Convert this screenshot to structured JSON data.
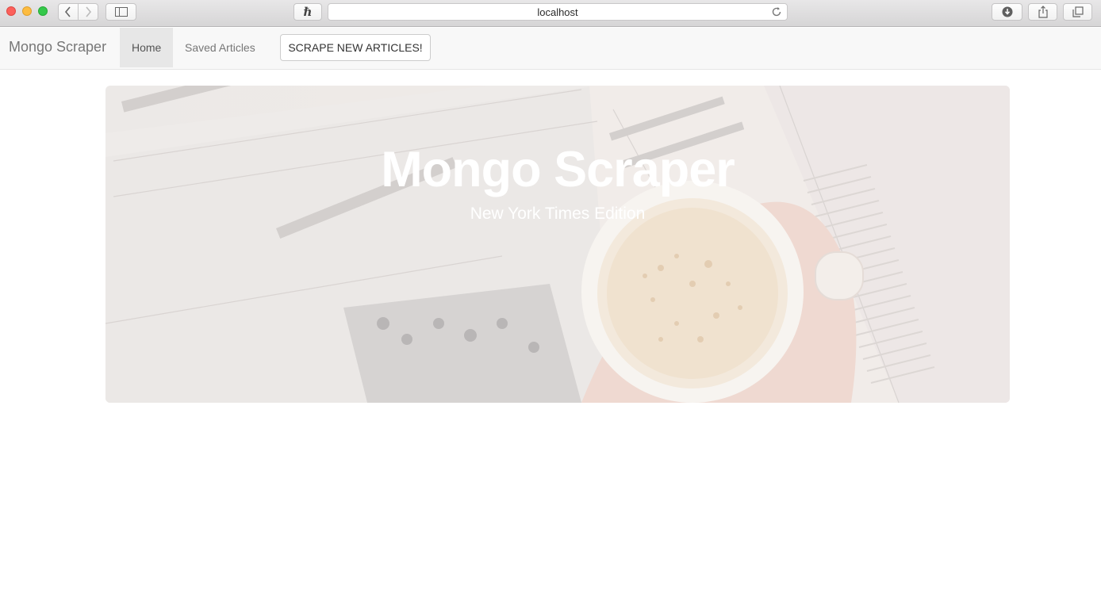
{
  "browser": {
    "address": "localhost",
    "extension_glyph": "ℏ"
  },
  "navbar": {
    "brand": "Mongo Scraper",
    "items": [
      {
        "label": "Home",
        "active": true
      },
      {
        "label": "Saved Articles",
        "active": false
      }
    ],
    "scrape_button": "SCRAPE NEW ARTICLES!"
  },
  "jumbotron": {
    "title": "Mongo Scraper",
    "subtitle": "New York Times Edition"
  }
}
